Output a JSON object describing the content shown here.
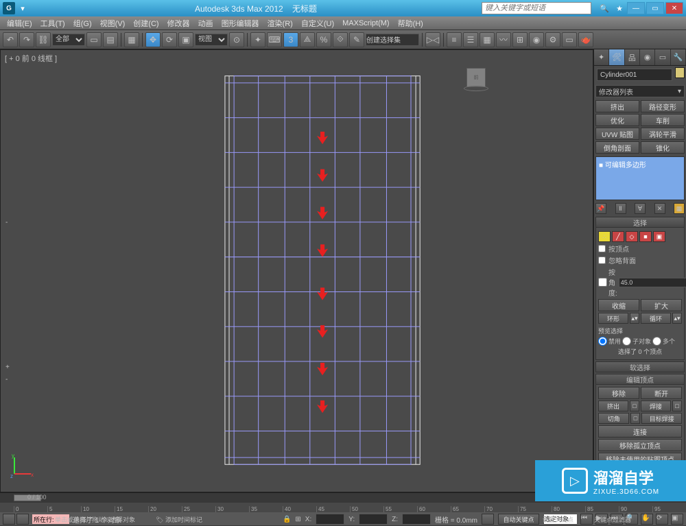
{
  "titlebar": {
    "app_title": "Autodesk 3ds Max  2012",
    "doc_title": "无标题",
    "search_placeholder": "键入关键字或短语"
  },
  "window_controls": {
    "min": "—",
    "max": "▭",
    "close": "✕"
  },
  "menus": [
    "编辑(E)",
    "工具(T)",
    "组(G)",
    "视图(V)",
    "创建(C)",
    "修改器",
    "动画",
    "图形编辑器",
    "渲染(R)",
    "自定义(U)",
    "MAXScript(M)",
    "帮助(H)"
  ],
  "toolbar": {
    "layer_dropdown": "全部",
    "view_dropdown": "视图",
    "named_sel": "创建选择集"
  },
  "viewport": {
    "label": "[ + 0 前 0 线框 ]",
    "cube_face": "前"
  },
  "command_panel": {
    "object_name": "Cylinder001",
    "modifier_dropdown": "修改器列表",
    "modifier_buttons": [
      "挤出",
      "路径变形",
      "优化",
      "车削",
      "UVW 贴图",
      "涡轮平滑",
      "倒角剖面",
      "锥化"
    ],
    "stack_item": "■ 可编辑多边形",
    "rollouts": {
      "selection": {
        "title": "选择",
        "by_vertex": "按顶点",
        "ignore_backfacing": "忽略背面",
        "by_angle": "按角度:",
        "angle_value": "45.0",
        "shrink": "收缩",
        "grow": "扩大",
        "ring": "环形",
        "loop": "循环",
        "preview_label": "预览选择",
        "preview_opts": [
          "禁用",
          "子对象",
          "多个"
        ],
        "status": "选择了 0 个顶点"
      },
      "soft_selection": {
        "title": "软选择"
      },
      "edit_vertices": {
        "title": "编辑顶点",
        "remove": "移除",
        "break": "断开",
        "extrude": "挤出",
        "weld": "焊接",
        "chamfer": "切角",
        "target_weld": "目标焊接",
        "connect": "连接",
        "remove_isolated": "移除孤立顶点",
        "remove_unused": "移除未使用的贴图顶点"
      }
    }
  },
  "timeline": {
    "range": "0 / 100"
  },
  "ruler_ticks": [
    "0",
    "5",
    "10",
    "15",
    "20",
    "25",
    "30",
    "35",
    "40",
    "45",
    "50",
    "55",
    "60",
    "65",
    "70",
    "75",
    "80",
    "85",
    "90",
    "95"
  ],
  "statusbar": {
    "selection_info": "选择了 1 个对象",
    "x_label": "X:",
    "y_label": "Y:",
    "z_label": "Z:",
    "grid": "栅格 = 0.0mm",
    "auto_key": "自动关键点",
    "sel_filter": "选定对象",
    "current_label": "所在行:",
    "prompt": "单击或单击并拖动以选择对象",
    "add_time_tag": "添加时间标记",
    "set_key": "设置关键点",
    "key_filter": "关键点过滤器"
  },
  "watermark": {
    "brand": "溜溜自学",
    "url": "ZIXUE.3D66.COM",
    "play": "▷"
  }
}
